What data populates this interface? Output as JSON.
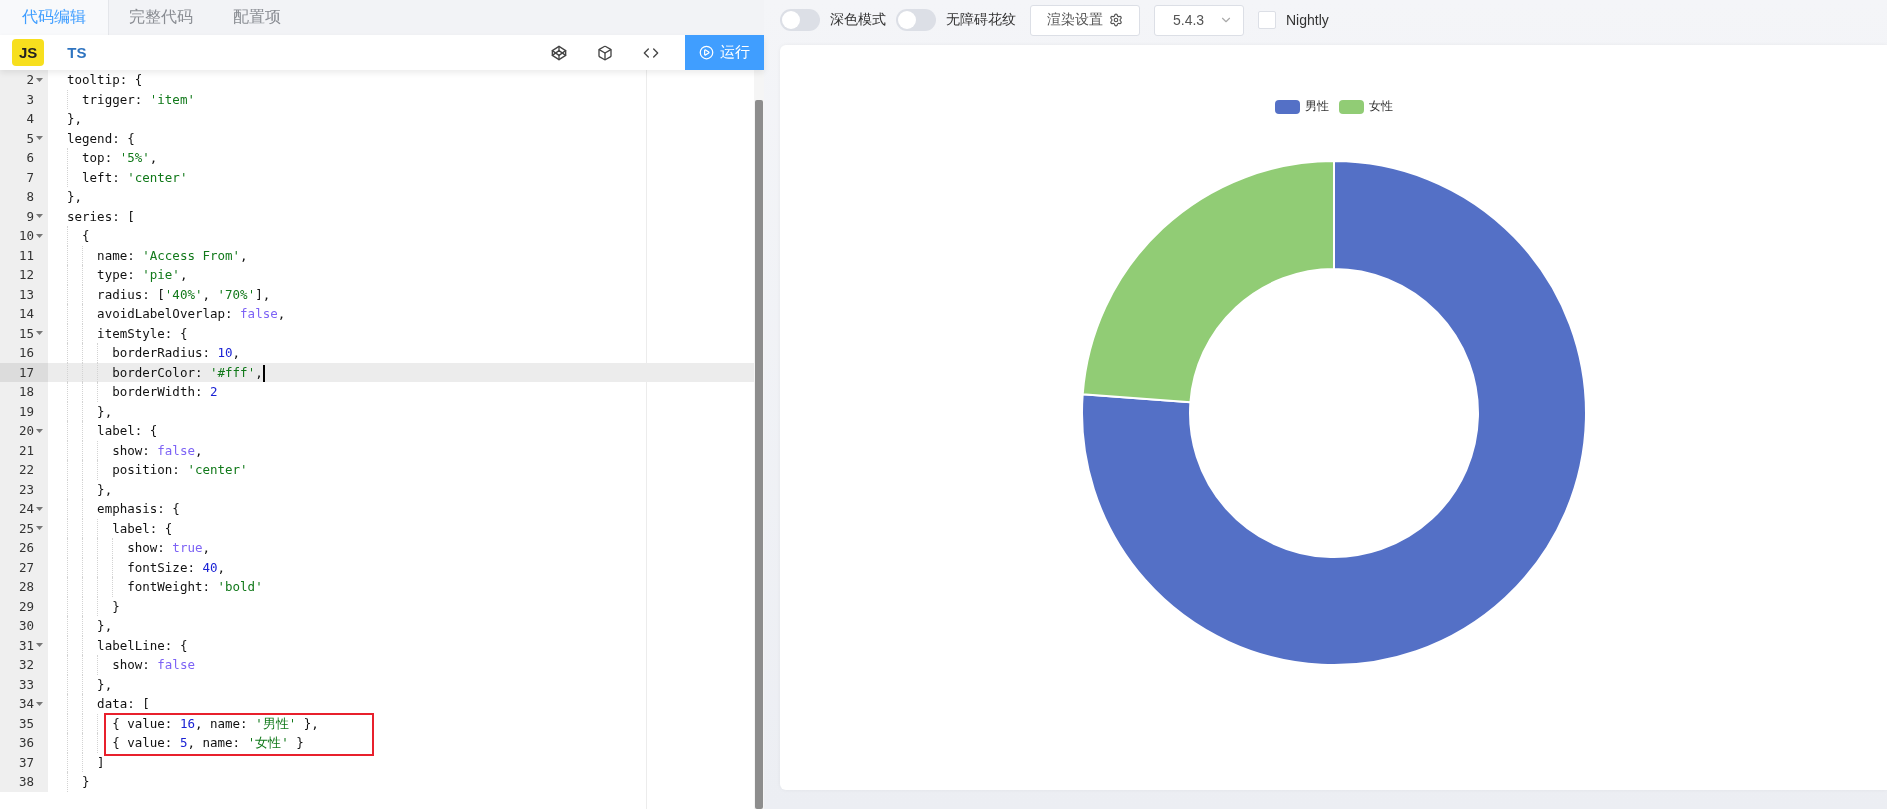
{
  "editor_tabs": [
    {
      "label": "代码编辑",
      "selected": true
    },
    {
      "label": "完整代码",
      "selected": false
    },
    {
      "label": "配置项",
      "selected": false
    }
  ],
  "language_tabs": [
    {
      "label": "JS",
      "selected": true
    },
    {
      "label": "TS",
      "selected": false
    }
  ],
  "run_button": {
    "label": "运行"
  },
  "code": {
    "lines": [
      {
        "number": "2",
        "foldable": true,
        "current": false,
        "boxed": false,
        "parts": [
          {
            "text": "tooltip: {",
            "kind": "plain"
          }
        ]
      },
      {
        "number": "3",
        "foldable": false,
        "current": false,
        "boxed": false,
        "parts": [
          {
            "text": "  trigger: ",
            "kind": "plain"
          },
          {
            "text": "'item'",
            "kind": "string"
          }
        ]
      },
      {
        "number": "4",
        "foldable": false,
        "current": false,
        "boxed": false,
        "parts": [
          {
            "text": "},",
            "kind": "plain"
          }
        ]
      },
      {
        "number": "5",
        "foldable": true,
        "current": false,
        "boxed": false,
        "parts": [
          {
            "text": "legend: {",
            "kind": "plain"
          }
        ]
      },
      {
        "number": "6",
        "foldable": false,
        "current": false,
        "boxed": false,
        "parts": [
          {
            "text": "  top: ",
            "kind": "plain"
          },
          {
            "text": "'5%'",
            "kind": "string"
          },
          {
            "text": ",",
            "kind": "plain"
          }
        ]
      },
      {
        "number": "7",
        "foldable": false,
        "current": false,
        "boxed": false,
        "parts": [
          {
            "text": "  left: ",
            "kind": "plain"
          },
          {
            "text": "'center'",
            "kind": "string"
          }
        ]
      },
      {
        "number": "8",
        "foldable": false,
        "current": false,
        "boxed": false,
        "parts": [
          {
            "text": "},",
            "kind": "plain"
          }
        ]
      },
      {
        "number": "9",
        "foldable": true,
        "current": false,
        "boxed": false,
        "parts": [
          {
            "text": "series: [",
            "kind": "plain"
          }
        ]
      },
      {
        "number": "10",
        "foldable": true,
        "current": false,
        "boxed": false,
        "parts": [
          {
            "text": "  {",
            "kind": "plain"
          }
        ]
      },
      {
        "number": "11",
        "foldable": false,
        "current": false,
        "boxed": false,
        "parts": [
          {
            "text": "    name: ",
            "kind": "plain"
          },
          {
            "text": "'Access From'",
            "kind": "string"
          },
          {
            "text": ",",
            "kind": "plain"
          }
        ]
      },
      {
        "number": "12",
        "foldable": false,
        "current": false,
        "boxed": false,
        "parts": [
          {
            "text": "    type: ",
            "kind": "plain"
          },
          {
            "text": "'pie'",
            "kind": "string"
          },
          {
            "text": ",",
            "kind": "plain"
          }
        ]
      },
      {
        "number": "13",
        "foldable": false,
        "current": false,
        "boxed": false,
        "parts": [
          {
            "text": "    radius: [",
            "kind": "plain"
          },
          {
            "text": "'40%'",
            "kind": "string"
          },
          {
            "text": ", ",
            "kind": "plain"
          },
          {
            "text": "'70%'",
            "kind": "string"
          },
          {
            "text": "],",
            "kind": "plain"
          }
        ]
      },
      {
        "number": "14",
        "foldable": false,
        "current": false,
        "boxed": false,
        "parts": [
          {
            "text": "    avoidLabelOverlap: ",
            "kind": "plain"
          },
          {
            "text": "false",
            "kind": "keyword"
          },
          {
            "text": ",",
            "kind": "plain"
          }
        ]
      },
      {
        "number": "15",
        "foldable": true,
        "current": false,
        "boxed": false,
        "parts": [
          {
            "text": "    itemStyle: {",
            "kind": "plain"
          }
        ]
      },
      {
        "number": "16",
        "foldable": false,
        "current": false,
        "boxed": false,
        "parts": [
          {
            "text": "      borderRadius: ",
            "kind": "plain"
          },
          {
            "text": "10",
            "kind": "number"
          },
          {
            "text": ",",
            "kind": "plain"
          }
        ]
      },
      {
        "number": "17",
        "foldable": false,
        "current": true,
        "boxed": false,
        "parts": [
          {
            "text": "      borderColor: ",
            "kind": "plain"
          },
          {
            "text": "'#fff'",
            "kind": "string"
          },
          {
            "text": ",",
            "kind": "plain"
          }
        ]
      },
      {
        "number": "18",
        "foldable": false,
        "current": false,
        "boxed": false,
        "parts": [
          {
            "text": "      borderWidth: ",
            "kind": "plain"
          },
          {
            "text": "2",
            "kind": "number"
          }
        ]
      },
      {
        "number": "19",
        "foldable": false,
        "current": false,
        "boxed": false,
        "parts": [
          {
            "text": "    },",
            "kind": "plain"
          }
        ]
      },
      {
        "number": "20",
        "foldable": true,
        "current": false,
        "boxed": false,
        "parts": [
          {
            "text": "    label: {",
            "kind": "plain"
          }
        ]
      },
      {
        "number": "21",
        "foldable": false,
        "current": false,
        "boxed": false,
        "parts": [
          {
            "text": "      show: ",
            "kind": "plain"
          },
          {
            "text": "false",
            "kind": "keyword"
          },
          {
            "text": ",",
            "kind": "plain"
          }
        ]
      },
      {
        "number": "22",
        "foldable": false,
        "current": false,
        "boxed": false,
        "parts": [
          {
            "text": "      position: ",
            "kind": "plain"
          },
          {
            "text": "'center'",
            "kind": "string"
          }
        ]
      },
      {
        "number": "23",
        "foldable": false,
        "current": false,
        "boxed": false,
        "parts": [
          {
            "text": "    },",
            "kind": "plain"
          }
        ]
      },
      {
        "number": "24",
        "foldable": true,
        "current": false,
        "boxed": false,
        "parts": [
          {
            "text": "    emphasis: {",
            "kind": "plain"
          }
        ]
      },
      {
        "number": "25",
        "foldable": true,
        "current": false,
        "boxed": false,
        "parts": [
          {
            "text": "      label: {",
            "kind": "plain"
          }
        ]
      },
      {
        "number": "26",
        "foldable": false,
        "current": false,
        "boxed": false,
        "parts": [
          {
            "text": "        show: ",
            "kind": "plain"
          },
          {
            "text": "true",
            "kind": "keyword"
          },
          {
            "text": ",",
            "kind": "plain"
          }
        ]
      },
      {
        "number": "27",
        "foldable": false,
        "current": false,
        "boxed": false,
        "parts": [
          {
            "text": "        fontSize: ",
            "kind": "plain"
          },
          {
            "text": "40",
            "kind": "number"
          },
          {
            "text": ",",
            "kind": "plain"
          }
        ]
      },
      {
        "number": "28",
        "foldable": false,
        "current": false,
        "boxed": false,
        "parts": [
          {
            "text": "        fontWeight: ",
            "kind": "plain"
          },
          {
            "text": "'bold'",
            "kind": "string"
          }
        ]
      },
      {
        "number": "29",
        "foldable": false,
        "current": false,
        "boxed": false,
        "parts": [
          {
            "text": "      }",
            "kind": "plain"
          }
        ]
      },
      {
        "number": "30",
        "foldable": false,
        "current": false,
        "boxed": false,
        "parts": [
          {
            "text": "    },",
            "kind": "plain"
          }
        ]
      },
      {
        "number": "31",
        "foldable": true,
        "current": false,
        "boxed": false,
        "parts": [
          {
            "text": "    labelLine: {",
            "kind": "plain"
          }
        ]
      },
      {
        "number": "32",
        "foldable": false,
        "current": false,
        "boxed": false,
        "parts": [
          {
            "text": "      show: ",
            "kind": "plain"
          },
          {
            "text": "false",
            "kind": "keyword"
          }
        ]
      },
      {
        "number": "33",
        "foldable": false,
        "current": false,
        "boxed": false,
        "parts": [
          {
            "text": "    },",
            "kind": "plain"
          }
        ]
      },
      {
        "number": "34",
        "foldable": true,
        "current": false,
        "boxed": false,
        "parts": [
          {
            "text": "    data: [",
            "kind": "plain"
          }
        ]
      },
      {
        "number": "35",
        "foldable": false,
        "current": false,
        "boxed": true,
        "parts": [
          {
            "text": "      { value: ",
            "kind": "plain"
          },
          {
            "text": "16",
            "kind": "number"
          },
          {
            "text": ", name: ",
            "kind": "plain"
          },
          {
            "text": "'男性'",
            "kind": "string"
          },
          {
            "text": " },",
            "kind": "plain"
          }
        ]
      },
      {
        "number": "36",
        "foldable": false,
        "current": false,
        "boxed": true,
        "parts": [
          {
            "text": "      { value: ",
            "kind": "plain"
          },
          {
            "text": "5",
            "kind": "number"
          },
          {
            "text": ", name: ",
            "kind": "plain"
          },
          {
            "text": "'女性'",
            "kind": "string"
          },
          {
            "text": " }",
            "kind": "plain"
          }
        ]
      },
      {
        "number": "37",
        "foldable": false,
        "current": false,
        "boxed": false,
        "parts": [
          {
            "text": "    ]",
            "kind": "plain"
          }
        ]
      },
      {
        "number": "38",
        "foldable": false,
        "current": false,
        "boxed": false,
        "parts": [
          {
            "text": "  }",
            "kind": "plain"
          }
        ]
      }
    ]
  },
  "toolbar": {
    "toggles": [
      {
        "label": "深色模式",
        "on": false
      },
      {
        "label": "无障碍花纹",
        "on": false
      }
    ],
    "render_settings": {
      "label": "渲染设置"
    },
    "version": {
      "value": "5.4.3"
    },
    "nightly": {
      "label": "Nightly",
      "checked": false
    }
  },
  "chart": {
    "slices": [
      {
        "color": "#5470c6"
      },
      {
        "color": "#91cc75"
      }
    ],
    "chart_data": {
      "type": "donut",
      "legend": "top",
      "categories": [
        "男性",
        "女性"
      ],
      "values": [
        76.19,
        23.81
      ]
    }
  }
}
